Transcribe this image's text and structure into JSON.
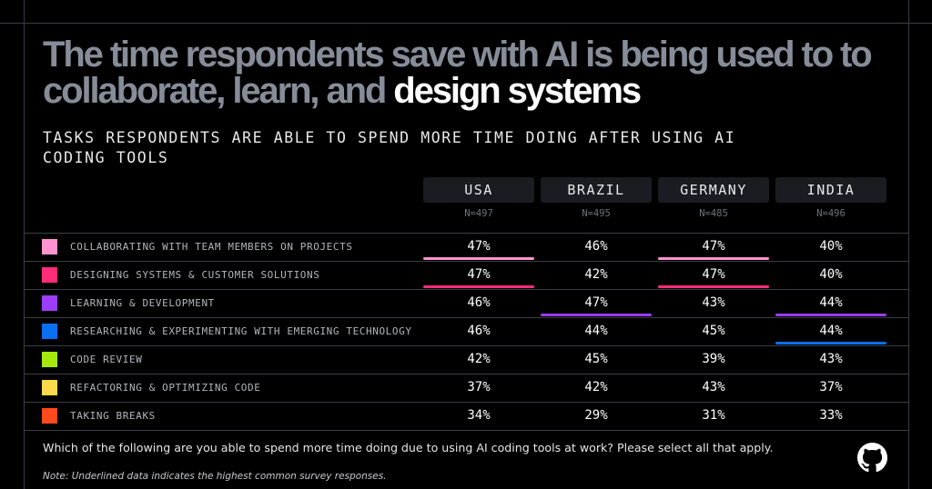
{
  "title": {
    "lead": "The time respondents save with AI is being used to to collaborate, learn, and",
    "highlight": "design systems"
  },
  "subtitle": "TASKS RESPONDENTS ARE ABLE TO SPEND MORE TIME DOING AFTER USING AI CODING TOOLS",
  "footer": {
    "question": "Which of the following are you able to spend more time doing due to using AI coding tools at work? Please select all that apply.",
    "note": "Note: Underlined data indicates the highest common survey responses.",
    "logo_icon": "github-icon"
  },
  "chart_data": {
    "type": "table",
    "title": "The time respondents save with AI is being used to to collaborate, learn, and design systems",
    "subtitle": "TASKS RESPONDENTS ARE ABLE TO SPEND MORE TIME DOING AFTER USING AI CODING TOOLS",
    "unit": "%",
    "columns": [
      {
        "name": "USA",
        "n": "N=497"
      },
      {
        "name": "BRAZIL",
        "n": "N=495"
      },
      {
        "name": "GERMANY",
        "n": "N=485"
      },
      {
        "name": "INDIA",
        "n": "N=496"
      }
    ],
    "rows": [
      {
        "label": "COLLABORATING WITH TEAM MEMBERS ON PROJECTS",
        "color": "#ff93cf",
        "values": [
          47,
          46,
          47,
          40
        ],
        "underlined": [
          true,
          false,
          true,
          false
        ]
      },
      {
        "label": "DESIGNING SYSTEMS & CUSTOMER SOLUTIONS",
        "color": "#ff2d78",
        "values": [
          47,
          42,
          47,
          40
        ],
        "underlined": [
          true,
          false,
          true,
          false
        ]
      },
      {
        "label": "LEARNING & DEVELOPMENT",
        "color": "#9c3dfa",
        "values": [
          46,
          47,
          43,
          44
        ],
        "underlined": [
          false,
          true,
          false,
          true
        ]
      },
      {
        "label": "RESEARCHING & EXPERIMENTING WITH EMERGING TECHNOLOGY",
        "color": "#0a6ff0",
        "values": [
          46,
          44,
          45,
          44
        ],
        "underlined": [
          false,
          false,
          false,
          true
        ]
      },
      {
        "label": "CODE REVIEW",
        "color": "#a4e80d",
        "values": [
          42,
          45,
          39,
          43
        ],
        "underlined": [
          false,
          false,
          false,
          false
        ]
      },
      {
        "label": "REFACTORING & OPTIMIZING CODE",
        "color": "#fcd94a",
        "values": [
          37,
          42,
          43,
          37
        ],
        "underlined": [
          false,
          false,
          false,
          false
        ]
      },
      {
        "label": "TAKING BREAKS",
        "color": "#ff4a1c",
        "values": [
          34,
          29,
          31,
          33
        ],
        "underlined": [
          false,
          false,
          false,
          false
        ]
      }
    ]
  }
}
